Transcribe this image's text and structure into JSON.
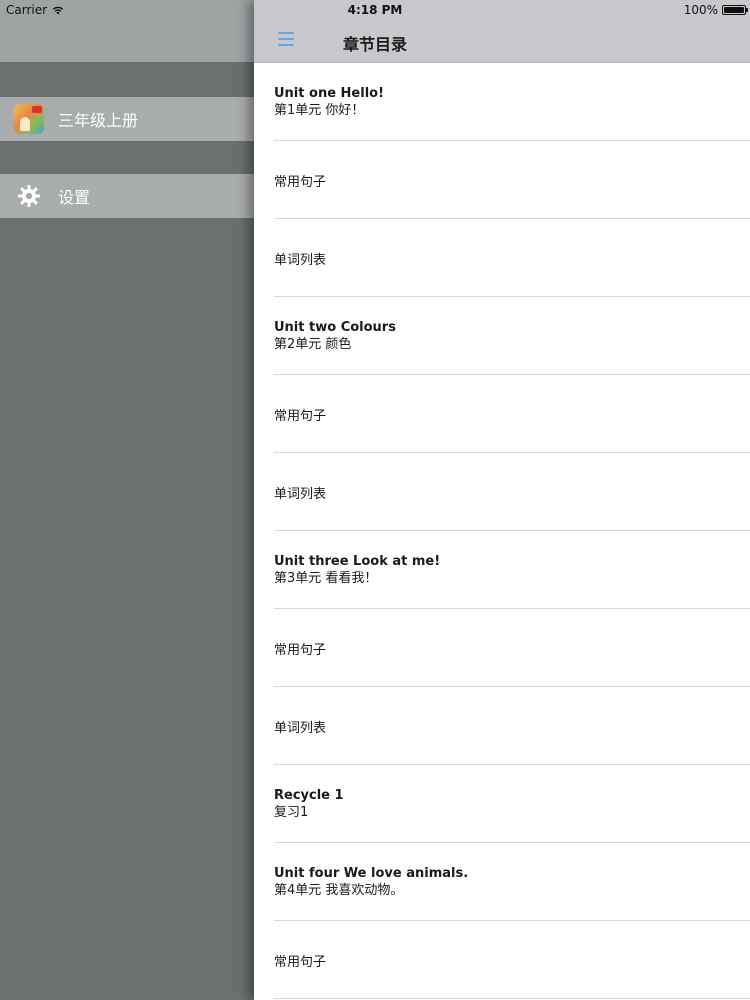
{
  "status_bar": {
    "carrier": "Carrier",
    "time": "4:18 PM",
    "battery": "100%"
  },
  "drawer": {
    "items": [
      {
        "label": "三年级上册",
        "icon": "book-cover-icon"
      },
      {
        "label": "设置",
        "icon": "gear-icon"
      }
    ]
  },
  "navbar": {
    "title": "章节目录",
    "menu_icon": "hamburger-menu-icon",
    "accent": "#6aa7d8"
  },
  "chapters": [
    {
      "title": "Unit one Hello!",
      "subtitle": "第1单元 你好！"
    },
    {
      "label": "常用句子"
    },
    {
      "label": "单词列表"
    },
    {
      "title": "Unit two Colours",
      "subtitle": "第2单元 颜色"
    },
    {
      "label": "常用句子"
    },
    {
      "label": "单词列表"
    },
    {
      "title": "Unit three Look at me!",
      "subtitle": "第3单元 看看我！"
    },
    {
      "label": "常用句子"
    },
    {
      "label": "单词列表"
    },
    {
      "title": "Recycle 1",
      "subtitle": "复习1"
    },
    {
      "title": "Unit four We love animals.",
      "subtitle": "第4单元 我喜欢动物。"
    },
    {
      "label": "常用句子"
    }
  ]
}
